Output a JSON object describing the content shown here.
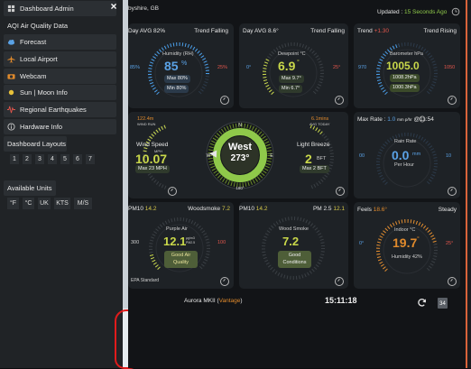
{
  "sidebar": {
    "items": [
      {
        "label": "Dashboard Admin",
        "icon": "dashboard-icon"
      },
      {
        "label": "AQI Air Quality Data",
        "icon": ""
      },
      {
        "label": "Forecast",
        "icon": "cloud-icon"
      },
      {
        "label": "Local Airport",
        "icon": "airplane-icon"
      },
      {
        "label": "Webcam",
        "icon": "camera-icon"
      },
      {
        "label": "Sun | Moon Info",
        "icon": "sun-icon"
      },
      {
        "label": "Regional Earthquakes",
        "icon": "seismograph-icon"
      },
      {
        "label": "Hardware Info",
        "icon": "info-icon"
      }
    ],
    "layouts_title": "Dashboard Layouts",
    "layouts": [
      "1",
      "2",
      "3",
      "4",
      "5",
      "6",
      "7"
    ],
    "units_title": "Available Units",
    "units": [
      "°F",
      "°C",
      "UK",
      "KTS",
      "M/S"
    ],
    "close_symbol": "×"
  },
  "header": {
    "location": "byshire, GB",
    "updated_prefix": "Updated :",
    "updated_value": "15 Seconds Ago"
  },
  "panels": {
    "humidity": {
      "title_left": "Day AVG 82",
      "title_left_unit": "%",
      "trend": "Trend Falling",
      "name": "Humidity (RH)",
      "value": "85",
      "unit": "%",
      "left_label": "85%",
      "right_label": "25%",
      "max": "Max 80%",
      "min": "Min 80%",
      "gauge_fraction": 0.85
    },
    "dewpoint": {
      "title_left": "Day AVG 8.6°",
      "trend": "Trend Falling",
      "name": "Dewpoint °C",
      "value": "6.9",
      "unit": "°",
      "left_label": "0°",
      "right_label": "25°",
      "max": "Max 9.7°",
      "min": "Min 6.7°",
      "gauge_fraction": 0.28
    },
    "barometer": {
      "title_left": "Trend",
      "title_delta": "+1.30",
      "trend": "Trend Rising",
      "name": "Barometer hPa",
      "value": "1005.0",
      "left_label": "970",
      "right_label": "1050",
      "max": "1008.2hPa",
      "min": "1000.3hPa",
      "gauge_fraction": 0.44
    },
    "wind": {
      "left_top_value": "122.4m",
      "left_top_label": "WIND RUN",
      "speed_name": "Wind Speed",
      "speed_sub": "MPH",
      "speed_value": "10.07",
      "speed_max": "Max 23 MPH",
      "direction_word": "West",
      "direction_deg": "273°",
      "compass": [
        "N",
        "E",
        "S",
        "W"
      ],
      "compass_bottom": "180°",
      "right_top_value": "6.1mins",
      "right_top_label": "AVG TODAY",
      "breeze_name": "Light Breeze",
      "breeze_value": "2",
      "breeze_unit": "BFT",
      "breeze_max": "Max 2 BFT",
      "speed_fraction": 0.43,
      "breeze_fraction": 0.17,
      "direction_degrees": 273
    },
    "rain": {
      "title_left": "Max Rate :",
      "title_value": "1.0",
      "title_unit": "mm p/hr",
      "title_time": "@11:54",
      "name": "Rain Rate",
      "value": "0.0",
      "unit": "mm",
      "sub": "Per Hour",
      "left_label": "00",
      "right_label": "10",
      "gauge_fraction": 0.0
    },
    "purple_air": {
      "title_left": "PM10",
      "title_left_value": "14.2",
      "title_right": "Woodsmoke",
      "title_right_value": "7.2",
      "name": "Purple Air",
      "value": "12.1",
      "unit": "μg/m3",
      "unit2": "PM2.5",
      "left_label": "300",
      "right_label": "100",
      "status_line1": "Good Air",
      "status_line2": "Quality",
      "footer": "EPA Standard",
      "gauge_fraction": 0.12
    },
    "woodsmoke": {
      "title_left": "PM10",
      "title_left_value": "14.2",
      "title_right": "PM 2.5",
      "title_right_value": "12.1",
      "name": "Wood Smoke",
      "value": "7.2",
      "status_line1": "Good",
      "status_line2": "Conditions"
    },
    "indoor": {
      "title_left": "Feels",
      "title_left_value": "18.6°",
      "trend": "Steady",
      "name": "Indoor °C",
      "value": "19.7",
      "unit": "°",
      "left_label": "0°",
      "right_label": "25°",
      "humidity": "Humidity 42%",
      "gauge_fraction": 0.79
    }
  },
  "footer": {
    "station": "Aurora MKII",
    "station_suffix": "Vantage",
    "time": "15:11:18",
    "calendar_day": "34"
  },
  "colors": {
    "accent_green": "#8fc94a",
    "accent_yellow": "#c9d84a",
    "accent_blue": "#4a9de6",
    "accent_red": "#e2564c",
    "accent_orange": "#e08a2c"
  }
}
